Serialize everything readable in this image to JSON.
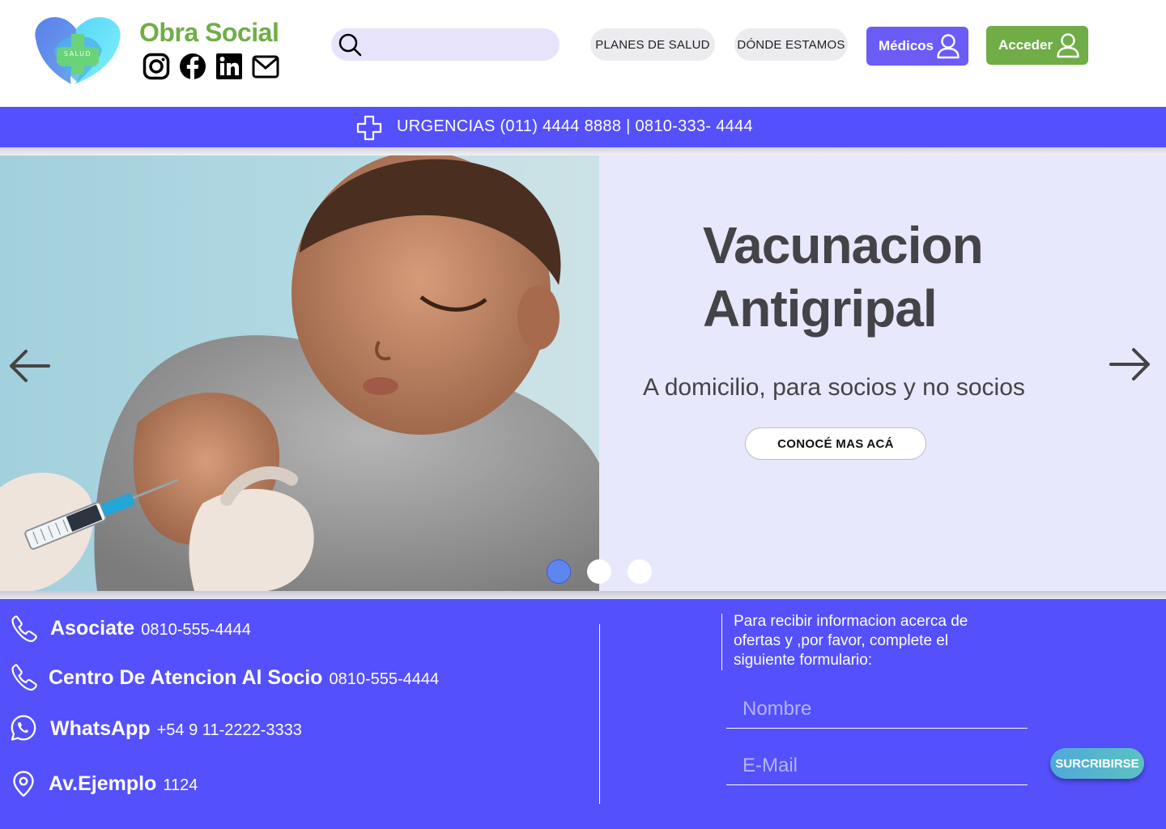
{
  "brand": {
    "name": "Obra Social",
    "logo_text": "SALUD",
    "colors": {
      "green": "#70ad47",
      "primary": "#5450fb",
      "accent": "#6b5cf6"
    }
  },
  "socials": [
    {
      "icon": "instagram-icon"
    },
    {
      "icon": "facebook-icon"
    },
    {
      "icon": "linkedin-icon"
    },
    {
      "icon": "mail-icon"
    }
  ],
  "search": {
    "placeholder": ""
  },
  "nav": {
    "planes": "PLANES DE SALUD",
    "donde": "DÓNDE ESTAMOS",
    "medicos": "Médicos",
    "acceder": "Acceder"
  },
  "urgency": {
    "text": "URGENCIAS (011) 4444 8888 | 0810-333- 4444"
  },
  "hero": {
    "title_line1": "Vacunacion",
    "title_line2": "Antigripal",
    "subtitle": "A domicilio, para socios y no socios",
    "cta": "CONOCÉ MAS ACÁ",
    "slides": 3,
    "active_slide": 1
  },
  "contacts": [
    {
      "label": "Asociate",
      "value": "0810-555-4444",
      "icon": "phone-icon"
    },
    {
      "label": "Centro De Atencion Al Socio",
      "value": "0810-555-4444",
      "icon": "phone-icon"
    },
    {
      "label": "WhatsApp",
      "value": "+54 9 11-2222-3333",
      "icon": "whatsapp-icon"
    },
    {
      "label": "Av.Ejemplo",
      "value": "1124",
      "icon": "location-pin-icon"
    }
  ],
  "newsletter": {
    "text": "Para recibir informacion acerca de ofertas y ,por favor, complete el siguiente formulario:",
    "name_placeholder": "Nombre",
    "email_placeholder": "E-Mail",
    "submit": "SURCRIBIRSE"
  }
}
